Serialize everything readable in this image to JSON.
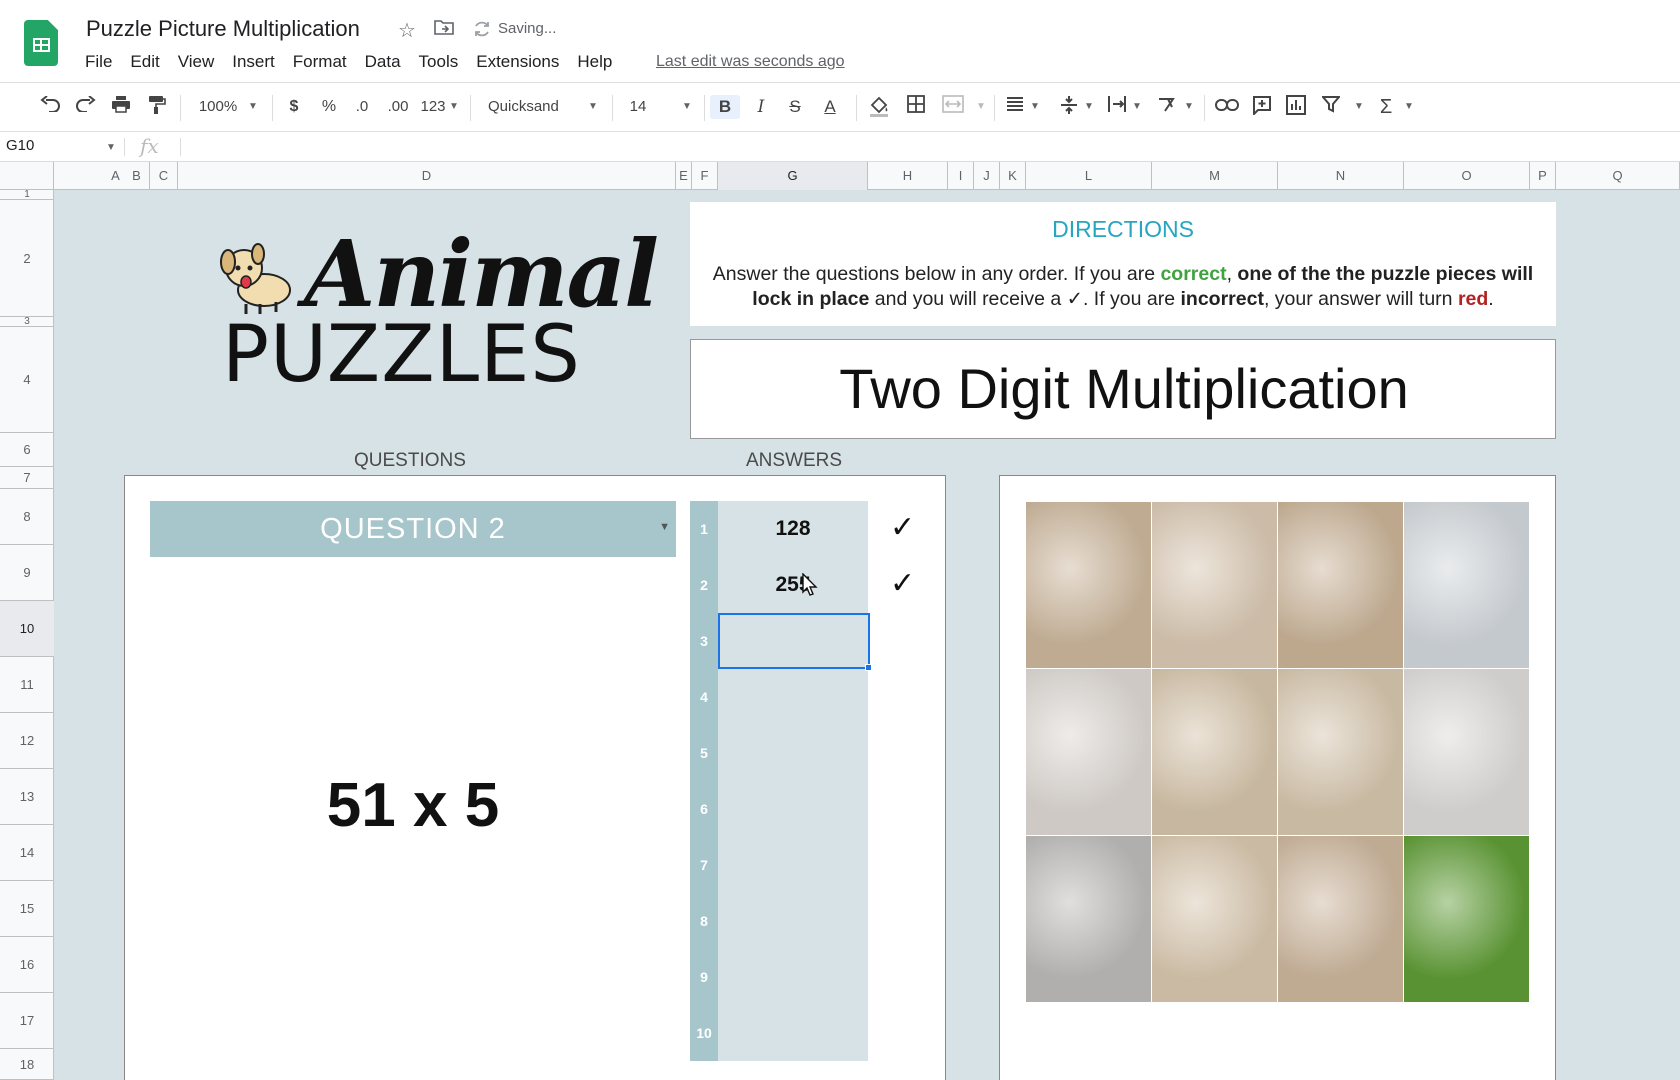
{
  "app": {
    "title": "Puzzle Picture Multiplication",
    "saving": "Saving...",
    "last_edit": "Last edit was seconds ago",
    "menu": [
      "File",
      "Edit",
      "View",
      "Insert",
      "Format",
      "Data",
      "Tools",
      "Extensions",
      "Help"
    ]
  },
  "toolbar": {
    "zoom": "100%",
    "currency": "$",
    "percent": "%",
    "dec_decrease": ".0",
    "dec_increase": ".00",
    "number_format": "123",
    "font": "Quicksand",
    "font_size": "14",
    "bold": "B",
    "italic": "I",
    "strike": "S",
    "text_color": "A"
  },
  "formula": {
    "cell_ref": "G10",
    "fx": "fx",
    "value": ""
  },
  "columns": [
    "A",
    "B",
    "C",
    "D",
    "E",
    "F",
    "G",
    "H",
    "I",
    "J",
    "K",
    "L",
    "M",
    "N",
    "O",
    "P",
    "Q"
  ],
  "rows": [
    "1",
    "2",
    "3",
    "4",
    "6",
    "7",
    "8",
    "9",
    "10",
    "11",
    "12",
    "13",
    "14",
    "15",
    "16",
    "17",
    "18"
  ],
  "sheet": {
    "logo_line1": "Animal",
    "logo_line2": "PUZZLES",
    "directions_title": "DIRECTIONS",
    "directions_p1": "Answer the questions below in any order. If you are ",
    "directions_correct": "correct",
    "directions_p2": ", ",
    "directions_bold1": "one of the the puzzle pieces will lock in place",
    "directions_p3": " and you will receive a ✓. If you are ",
    "directions_incorrect": "incorrect",
    "directions_p4": ", your answer will turn ",
    "directions_red": "red",
    "directions_p5": ".",
    "topic": "Two Digit Multiplication",
    "questions_label": "QUESTIONS",
    "answers_label": "ANSWERS",
    "question_selected": "QUESTION 2",
    "problem": "51 x 5",
    "answer_numbers": [
      "1",
      "2",
      "3",
      "4",
      "5",
      "6",
      "7",
      "8",
      "9",
      "10"
    ],
    "answers": [
      "128",
      "255",
      "",
      "",
      "",
      "",
      "",
      "",
      "",
      ""
    ],
    "checks": [
      "✓",
      "✓"
    ],
    "colors": {
      "background": "#d6e2e6",
      "accent_teal": "#a7c6cb",
      "title_blue": "#26a6c0",
      "correct_green": "#3fa33f",
      "incorrect_red": "#b22222",
      "selection_blue": "#1a73e8"
    },
    "puzzle_tiles": [
      {
        "color": "#c9b49a"
      },
      {
        "color": "#d6c5b0"
      },
      {
        "color": "#c7b196"
      },
      {
        "color": "#cfd4d8"
      },
      {
        "color": "#d9d4cf"
      },
      {
        "color": "#d2c1a8"
      },
      {
        "color": "#d3c3ab"
      },
      {
        "color": "#dad8d6"
      },
      {
        "color": "#b9b8b6"
      },
      {
        "color": "#d5c4ac"
      },
      {
        "color": "#c9b39a"
      },
      {
        "color": "#5e9a35"
      }
    ]
  }
}
